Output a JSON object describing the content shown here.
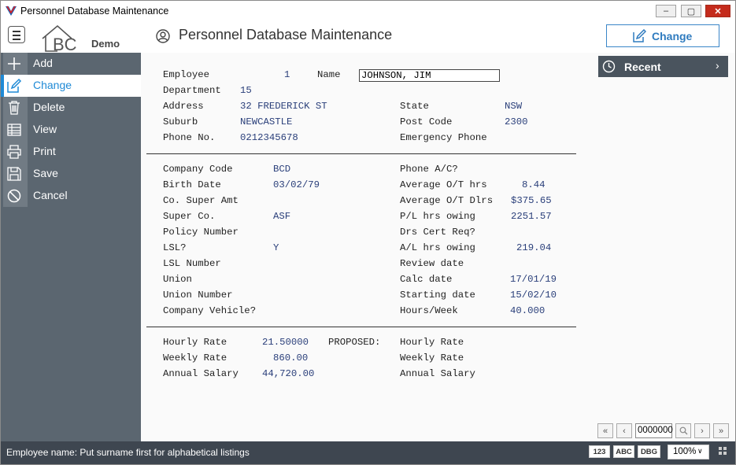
{
  "window": {
    "title": "Personnel Database Maintenance"
  },
  "header": {
    "logo_text": "BC",
    "logo_sub": "Demo",
    "page_title": "Personnel Database Maintenance",
    "action_button": "Change"
  },
  "sidebar": {
    "items": [
      {
        "label": "Add",
        "icon": "plus-icon"
      },
      {
        "label": "Change",
        "icon": "edit-icon",
        "active": true
      },
      {
        "label": "Delete",
        "icon": "trash-icon"
      },
      {
        "label": "View",
        "icon": "table-icon"
      },
      {
        "label": "Print",
        "icon": "printer-icon"
      },
      {
        "label": "Save",
        "icon": "save-icon"
      },
      {
        "label": "Cancel",
        "icon": "cancel-icon"
      }
    ]
  },
  "recent": {
    "label": "Recent"
  },
  "form": {
    "employee_label": "Employee",
    "employee": "1",
    "name_label": "Name",
    "name": "JOHNSON, JIM",
    "department_label": "Department",
    "department": "15",
    "address_label": "Address",
    "address": "32 FREDERICK ST",
    "state_label": "State",
    "state": "NSW",
    "suburb_label": "Suburb",
    "suburb": "NEWCASTLE",
    "postcode_label": "Post Code",
    "postcode": "2300",
    "phone_label": "Phone No.",
    "phone": "0212345678",
    "emergency_label": "Emergency Phone",
    "company_code_label": "Company Code",
    "company_code": "BCD",
    "phone_ac_label": "Phone A/C?",
    "birth_date_label": "Birth Date",
    "birth_date": "03/02/79",
    "avg_ot_hrs_label": "Average O/T hrs",
    "avg_ot_hrs": "8.44",
    "co_super_label": "Co. Super Amt",
    "avg_ot_dlrs_label": "Average O/T Dlrs",
    "avg_ot_dlrs": "$375.65",
    "super_co_label": "Super Co.",
    "super_co": "ASF",
    "pl_hrs_label": "P/L hrs owing",
    "pl_hrs": "2251.57",
    "policy_label": "Policy Number",
    "drs_cert_label": "Drs Cert Req?",
    "lsl_label": "LSL?",
    "lsl": "Y",
    "al_hrs_label": "A/L hrs owing",
    "al_hrs": "219.04",
    "lsl_number_label": "LSL Number",
    "review_label": "Review date",
    "union_label": "Union",
    "calc_label": "Calc date",
    "calc": "17/01/19",
    "union_number_label": "Union Number",
    "starting_label": "Starting date",
    "starting": "15/02/10",
    "vehicle_label": "Company Vehicle?",
    "hours_week_label": "Hours/Week",
    "hours_week": "40.000",
    "hourly_rate_label": "Hourly Rate",
    "hourly_rate": "21.50000",
    "proposed_label": "PROPOSED:",
    "p_hourly_label": "Hourly Rate",
    "weekly_rate_label": "Weekly Rate",
    "weekly_rate": "860.00",
    "p_weekly_label": "Weekly Rate",
    "annual_label": "Annual Salary",
    "annual": "44,720.00",
    "p_annual_label": "Annual Salary"
  },
  "pager": {
    "record": "0000000"
  },
  "status": {
    "message": "Employee name: Put surname first for alphabetical listings",
    "btn_123": "123",
    "btn_abc": "ABC",
    "btn_dbg": "DBG",
    "zoom": "100%"
  }
}
